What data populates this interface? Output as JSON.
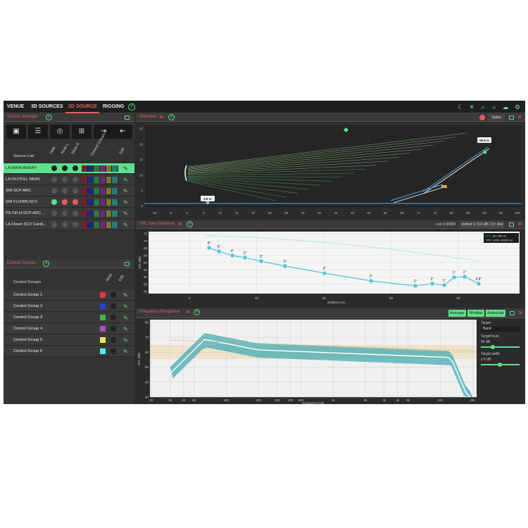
{
  "tabs": [
    {
      "label": "VENUE"
    },
    {
      "label": "3D SOURCES"
    },
    {
      "label": "2D SOURCE"
    },
    {
      "label": "RIGGING"
    }
  ],
  "top_icons": [
    "moon-icon",
    "sun-icon",
    "zoom-out-icon",
    "zoom-in-icon",
    "cloud-upload-icon",
    "settings-icon"
  ],
  "source_manager": {
    "title": "Source Manager",
    "tools": [
      "speaker-icon",
      "array-icon",
      "subwoofer-icon",
      "add-folder-icon",
      "import-icon",
      "export-icon"
    ],
    "headers": {
      "list": "Source List",
      "hide": "Hide",
      "mute_l": "Mute L",
      "mute_r": "Mute R",
      "control": "Control Groups",
      "edit": "Edit"
    },
    "sources": [
      {
        "type": "LA",
        "name": "MAIN ARRAY",
        "selected": true,
        "dots": [
          "dark",
          "dark",
          "dark"
        ]
      },
      {
        "type": "LA",
        "name": "OUTFILL NRAY",
        "selected": false,
        "dots": [
          "gray",
          "gray",
          "gray"
        ]
      },
      {
        "type": "SW",
        "name": "SCP ARC",
        "selected": false,
        "dots": [
          "gray",
          "gray",
          "gray"
        ]
      },
      {
        "type": "SW",
        "name": "FLOWN SCV",
        "selected": false,
        "dots": [
          "green",
          "red",
          "red"
        ]
      },
      {
        "type": "PS",
        "name": "Fill of SCP ARC ...",
        "selected": false,
        "dots": [
          "gray",
          "gray",
          "gray"
        ]
      },
      {
        "type": "LA",
        "name": "Flown SCV Cardi...",
        "selected": false,
        "dots": [
          "gray",
          "gray",
          "gray"
        ]
      }
    ],
    "swatch_colors": [
      "#7a1e2a",
      "#1e2a7a",
      "#2a7a3a",
      "#6a2a7a",
      "#7a7a2a",
      "#2a7a7a"
    ]
  },
  "control_groups": {
    "title": "Control Groups",
    "header": "Control Groups",
    "mute_label": "Mute",
    "edit_label": "Edit",
    "groups": [
      {
        "name": "Control Group 1",
        "color": "#e03c3c"
      },
      {
        "name": "Control Group 2",
        "color": "#2a3cd8"
      },
      {
        "name": "Control Group 3",
        "color": "#4fb04f"
      },
      {
        "name": "Control Group 4",
        "color": "#b04fc0"
      },
      {
        "name": "Control Group 5",
        "color": "#f0e060"
      },
      {
        "name": "Control Group 6",
        "color": "#4ff0f0"
      }
    ]
  },
  "sideview": {
    "title": "Sideview",
    "splay_label": "Splay",
    "label_top": "66.8 m",
    "label_left": "5.8 m",
    "x_ticks": [
      "-10",
      "-5",
      "0",
      "5",
      "10",
      "15",
      "20",
      "25",
      "30",
      "35",
      "40",
      "45",
      "50",
      "55",
      "60",
      "65",
      "70",
      "75",
      "80",
      "85",
      "90",
      "95",
      "100"
    ],
    "y_ticks": [
      "25",
      "20",
      "15",
      "10",
      "5",
      "0"
    ]
  },
  "spl": {
    "title": "SPL over Distance",
    "corr": "corr 0.8300",
    "mode": "dotted ∨ 6.0 dB / 2× dist",
    "legend": [
      "80–250 Hz",
      "1000–10000 Hz"
    ],
    "y_ticks": [
      "72",
      "70",
      "68",
      "66",
      "64",
      "62",
      "60",
      "58",
      "56"
    ],
    "x_ticks": [
      "0",
      "20",
      "40",
      "60",
      "80"
    ],
    "xlabel": "Distance (m)",
    "ylabel": "SPL (dB)",
    "angles": [
      "8°",
      "6°",
      "4°",
      "3°",
      "3°",
      "3°",
      "2°",
      "2°",
      "2°",
      "2°",
      "1°",
      "1°",
      "1°",
      "0.8°"
    ]
  },
  "freq": {
    "title": "Frequency Response",
    "buttons": [
      "Average",
      "Window",
      "Autoscale"
    ],
    "y_ticks": [
      "80",
      "70",
      "60",
      "50",
      "40",
      "30"
    ],
    "x_ticks": [
      "20",
      "30",
      "40",
      "50",
      "100",
      "200",
      "300",
      "400",
      "500",
      "1k",
      "2k",
      "3k",
      "4k",
      "5k",
      "10k",
      "20k"
    ],
    "xlabel": "Frequency (Hz)",
    "ylabel": "SPL (dB)",
    "target_label": "Target",
    "target_value": "Band",
    "target_level_label": "Target level",
    "target_level_value": "56 dB",
    "target_width_label": "Target width",
    "target_width_value": "± 6 dB"
  },
  "colors": {
    "accent": "#5fe08a",
    "alert": "#e85d5d",
    "curve": "#4fc3d9"
  }
}
